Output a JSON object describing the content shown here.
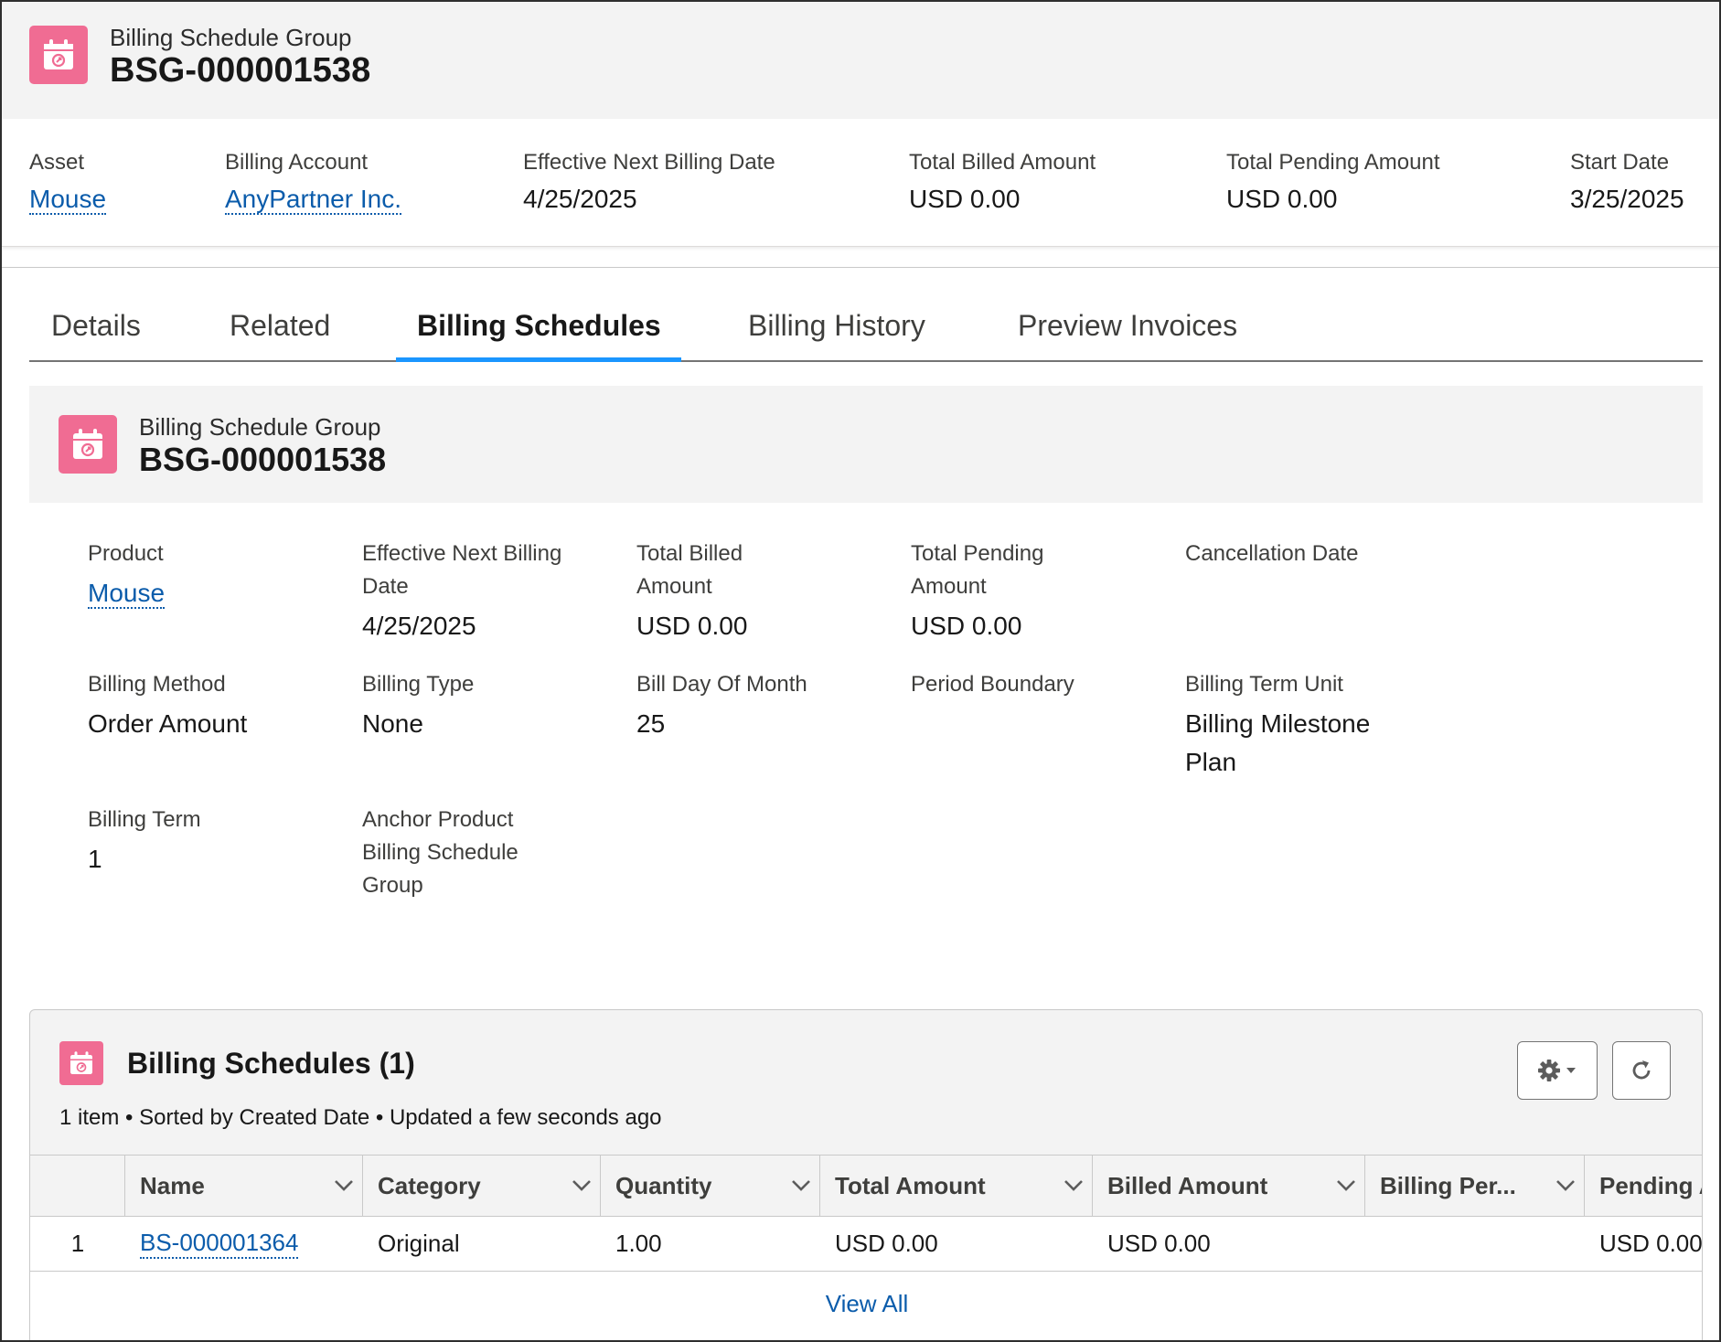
{
  "header": {
    "object_type": "Billing Schedule Group",
    "record_name": "BSG-000001538"
  },
  "highlights": [
    {
      "label": "Asset",
      "value": "Mouse",
      "is_link": true
    },
    {
      "label": "Billing Account",
      "value": "AnyPartner Inc.",
      "is_link": true
    },
    {
      "label": "Effective Next Billing Date",
      "value": "4/25/2025",
      "is_link": false
    },
    {
      "label": "Total Billed Amount",
      "value": "USD 0.00",
      "is_link": false
    },
    {
      "label": "Total Pending Amount",
      "value": "USD 0.00",
      "is_link": false
    },
    {
      "label": "Start Date",
      "value": "3/25/2025",
      "is_link": false
    }
  ],
  "tabs": [
    {
      "label": "Details",
      "active": false
    },
    {
      "label": "Related",
      "active": false
    },
    {
      "label": "Billing Schedules",
      "active": true
    },
    {
      "label": "Billing History",
      "active": false
    },
    {
      "label": "Preview Invoices",
      "active": false
    }
  ],
  "card": {
    "object_type": "Billing Schedule Group",
    "record_name": "BSG-000001538",
    "fields": [
      {
        "label": "Product",
        "value": "Mouse",
        "is_link": true
      },
      {
        "label": "Effective Next Billing Date",
        "value": "4/25/2025"
      },
      {
        "label": "Total Billed Amount",
        "value": "USD 0.00"
      },
      {
        "label": "Total Pending Amount",
        "value": "USD 0.00"
      },
      {
        "label": "Cancellation Date",
        "value": ""
      },
      {
        "label": "Billing Method",
        "value": "Order Amount"
      },
      {
        "label": "Billing Type",
        "value": "None"
      },
      {
        "label": "Bill Day Of Month",
        "value": "25"
      },
      {
        "label": "Period Boundary",
        "value": ""
      },
      {
        "label": "Billing Term Unit",
        "value": "Billing Milestone Plan"
      },
      {
        "label": "Billing Term",
        "value": "1"
      },
      {
        "label": "Anchor Product Billing Schedule Group",
        "value": ""
      }
    ]
  },
  "related_list": {
    "title": "Billing Schedules (1)",
    "meta": "1 item • Sorted by Created Date • Updated a few seconds ago",
    "columns": [
      "Name",
      "Category",
      "Quantity",
      "Total Amount",
      "Billed Amount",
      "Billing Per...",
      "Pending A"
    ],
    "rows": [
      {
        "num": "1",
        "name": "BS-000001364",
        "category": "Original",
        "quantity": "1.00",
        "total_amount": "USD 0.00",
        "billed_amount": "USD 0.00",
        "billing_period": "",
        "pending_amount": "USD 0.00"
      }
    ],
    "view_all": "View All"
  },
  "colors": {
    "icon_bg": "#f06c93",
    "link": "#0b5cab",
    "tab_active": "#1b96ff",
    "header_bg": "#f3f3f3"
  }
}
